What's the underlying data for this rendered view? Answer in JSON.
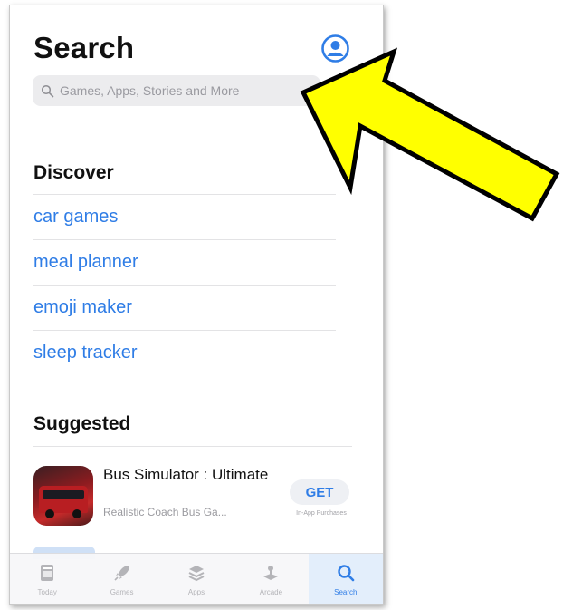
{
  "page": {
    "title": "Search"
  },
  "search": {
    "placeholder": "Games, Apps, Stories and More"
  },
  "discover": {
    "heading": "Discover",
    "items": [
      "car games",
      "meal planner",
      "emoji maker",
      "sleep tracker"
    ]
  },
  "suggested": {
    "heading": "Suggested",
    "app": {
      "name": "Bus Simulator : Ultimate",
      "subtitle": "Realistic Coach Bus Ga...",
      "button_label": "GET",
      "iap_note": "In-App Purchases"
    }
  },
  "tabs": [
    {
      "label": "Today",
      "icon": "today-icon"
    },
    {
      "label": "Games",
      "icon": "rocket-icon"
    },
    {
      "label": "Apps",
      "icon": "layers-icon"
    },
    {
      "label": "Arcade",
      "icon": "arcade-icon"
    },
    {
      "label": "Search",
      "icon": "search-icon",
      "active": true
    }
  ],
  "colors": {
    "accent": "#2f7de6",
    "arrow_fill": "#ffff00",
    "arrow_outline": "#000000"
  }
}
